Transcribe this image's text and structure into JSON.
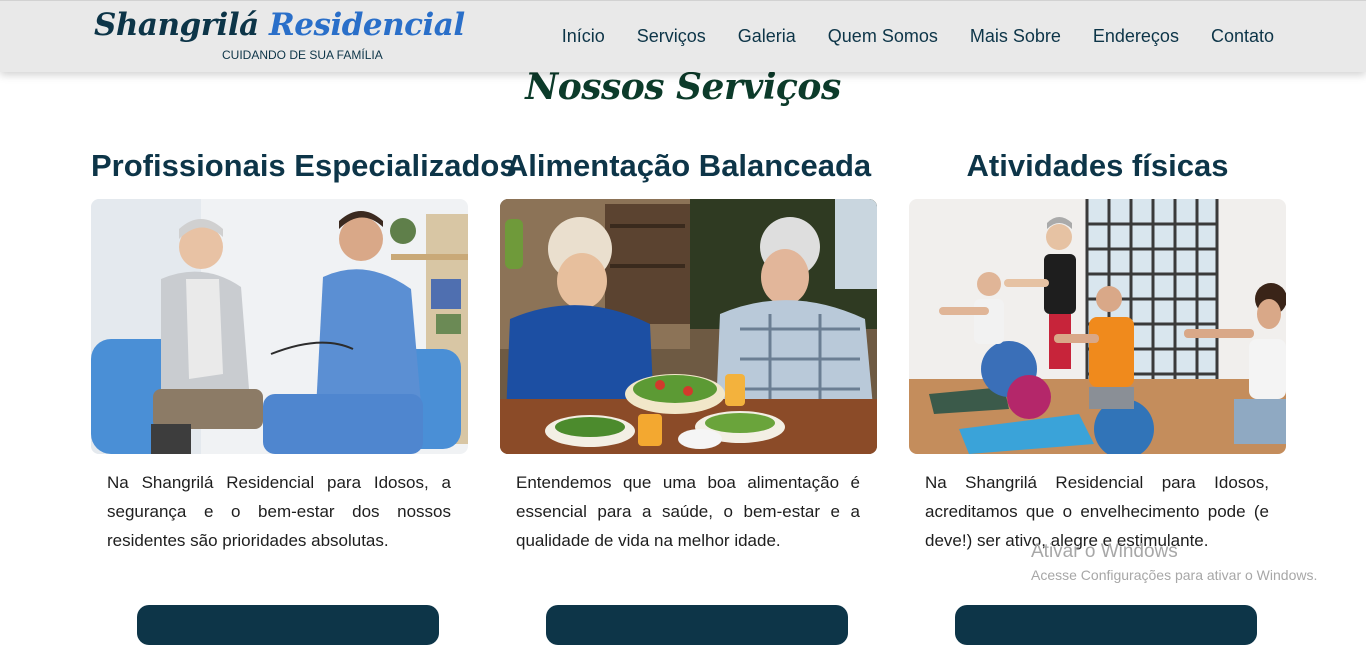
{
  "header": {
    "brand_part1": "Shangrilá",
    "brand_part2": "Residencial",
    "tagline": "CUIDANDO DE SUA FAMÍLIA",
    "nav": [
      "Início",
      "Serviços",
      "Galeria",
      "Quem Somos",
      "Mais Sobre",
      "Endereços",
      "Contato"
    ]
  },
  "services": {
    "title": "Nossos Serviços",
    "cards": [
      {
        "title": "Profissionais Especializados",
        "text": "Na Shangrilá Residencial para Idosos, a segurança e o bem-estar dos nossos residentes são prioridades absolutas."
      },
      {
        "title": "Alimentação Balanceada",
        "text": "Entendemos que uma boa alimentação é essencial para a saúde, o bem-estar e a qualidade de vida na melhor idade."
      },
      {
        "title": "Atividades físicas",
        "text": "Na Shangrilá Residencial para Idosos, acreditamos que o envelhecimento pode (e deve!) ser ativo, alegre e estimulante."
      }
    ]
  },
  "watermark": {
    "title": "Ativar o Windows",
    "subtitle": "Acesse Configurações para ativar o Windows."
  },
  "colors": {
    "primary": "#0d3548",
    "brand_blue": "#2a6fc9",
    "title_green": "#0c3b2a",
    "header_bg": "#e9e9e9"
  }
}
